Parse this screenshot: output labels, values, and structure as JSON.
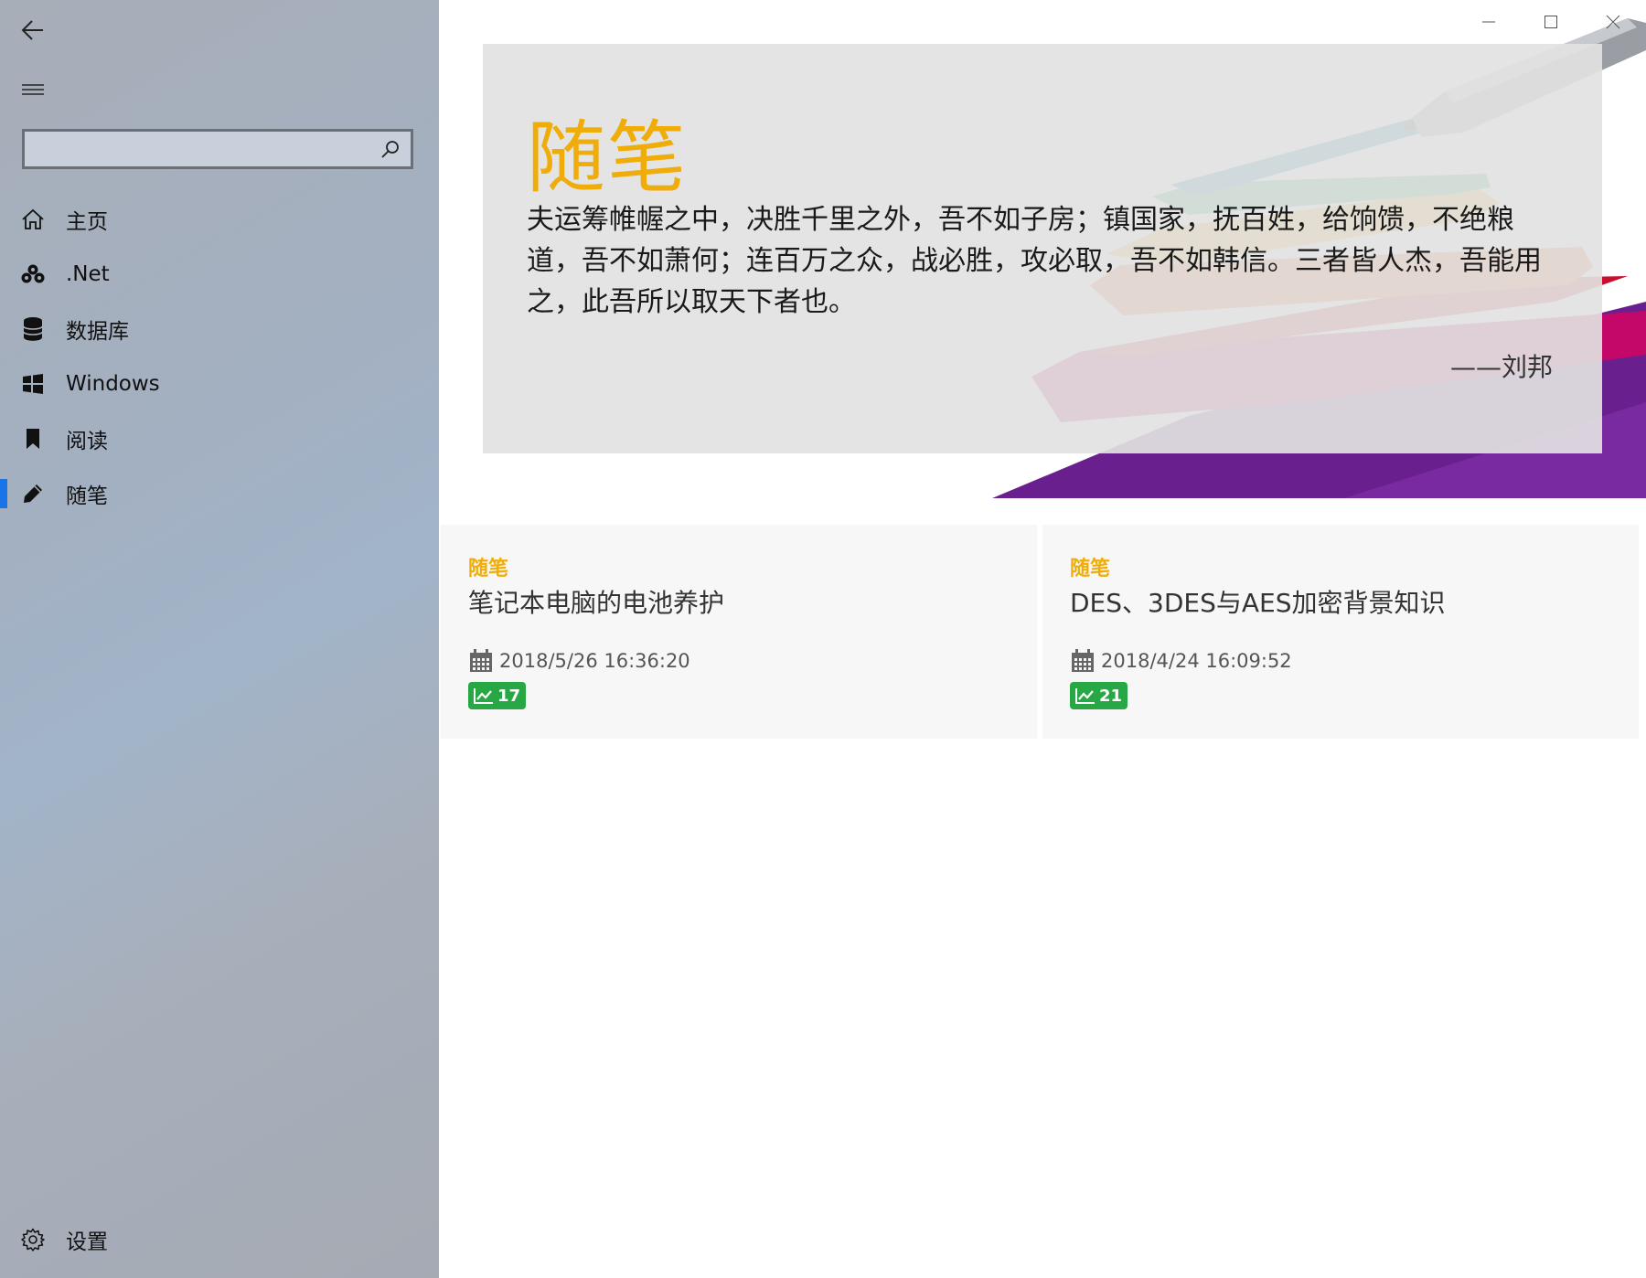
{
  "sidebar": {
    "search": {
      "value": "",
      "placeholder": ""
    },
    "items": [
      {
        "label": "主页",
        "icon": "home-icon"
      },
      {
        "label": ".Net",
        "icon": "dotnet-icon"
      },
      {
        "label": "数据库",
        "icon": "database-icon"
      },
      {
        "label": "Windows",
        "icon": "windows-logo-icon"
      },
      {
        "label": "阅读",
        "icon": "bookmark-icon"
      },
      {
        "label": "随笔",
        "icon": "pencil-icon",
        "selected": true
      }
    ],
    "settings_label": "设置"
  },
  "hero": {
    "title": "随笔",
    "quote": "夫运筹帷幄之中，决胜千里之外，吾不如子房；镇国家，抚百姓，给饷馈，不绝粮道，吾不如萧何；连百万之众，战必胜，攻必取，吾不如韩信。三者皆人杰，吾能用之，此吾所以取天下者也。",
    "author": "——刘邦"
  },
  "posts": [
    {
      "category": "随笔",
      "title": "笔记本电脑的电池养护",
      "date": "2018/5/26 16:36:20",
      "views": "17"
    },
    {
      "category": "随笔",
      "title": "DES、3DES与AES加密背景知识",
      "date": "2018/4/24 16:09:52",
      "views": "21"
    }
  ],
  "colors": {
    "accent": "#f0ad0a",
    "selection": "#1a73e8",
    "badge": "#28a745"
  }
}
